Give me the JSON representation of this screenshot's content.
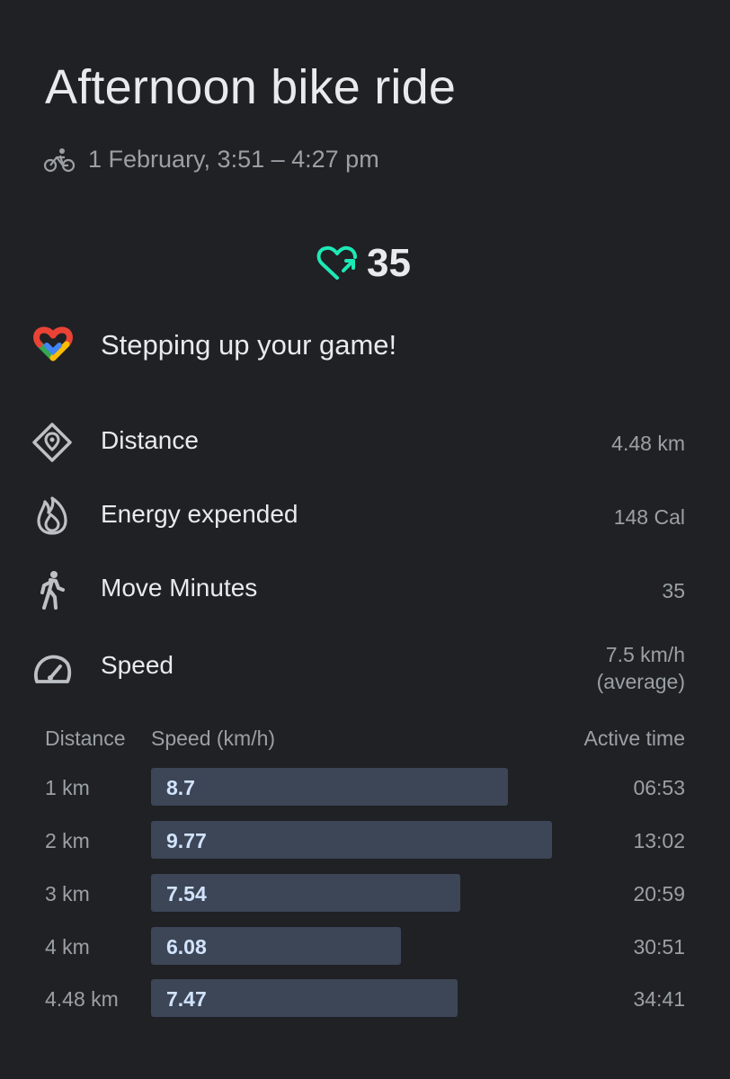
{
  "header": {
    "title": "Afternoon bike ride",
    "datetime": "1 February, 3:51 – 4:27 pm",
    "activity_icon": "bicycle-icon"
  },
  "heart_points": {
    "value": "35",
    "icon": "heart-points-icon",
    "color": "#1de9b6"
  },
  "achievement": {
    "label": "Stepping up your game!",
    "icon": "google-fit-heart-icon"
  },
  "metrics": [
    {
      "label": "Distance",
      "value": "4.48 km",
      "icon": "location-pin-diamond-icon"
    },
    {
      "label": "Energy expended",
      "value": "148 Cal",
      "icon": "flame-icon"
    },
    {
      "label": "Move Minutes",
      "value": "35",
      "icon": "walking-person-icon"
    },
    {
      "label": "Speed",
      "value_line1": "7.5 km/h",
      "value_line2": "(average)",
      "icon": "speedometer-icon"
    }
  ],
  "splits": {
    "headers": {
      "distance": "Distance",
      "speed": "Speed (km/h)",
      "time": "Active time"
    },
    "max_speed": 9.77,
    "rows": [
      {
        "distance": "1 km",
        "speed": "8.7",
        "time": "06:53"
      },
      {
        "distance": "2 km",
        "speed": "9.77",
        "time": "13:02"
      },
      {
        "distance": "3 km",
        "speed": "7.54",
        "time": "20:59"
      },
      {
        "distance": "4 km",
        "speed": "6.08",
        "time": "30:51"
      },
      {
        "distance": "4.48 km",
        "speed": "7.47",
        "time": "34:41"
      }
    ],
    "bar_color": "#3c4657"
  }
}
